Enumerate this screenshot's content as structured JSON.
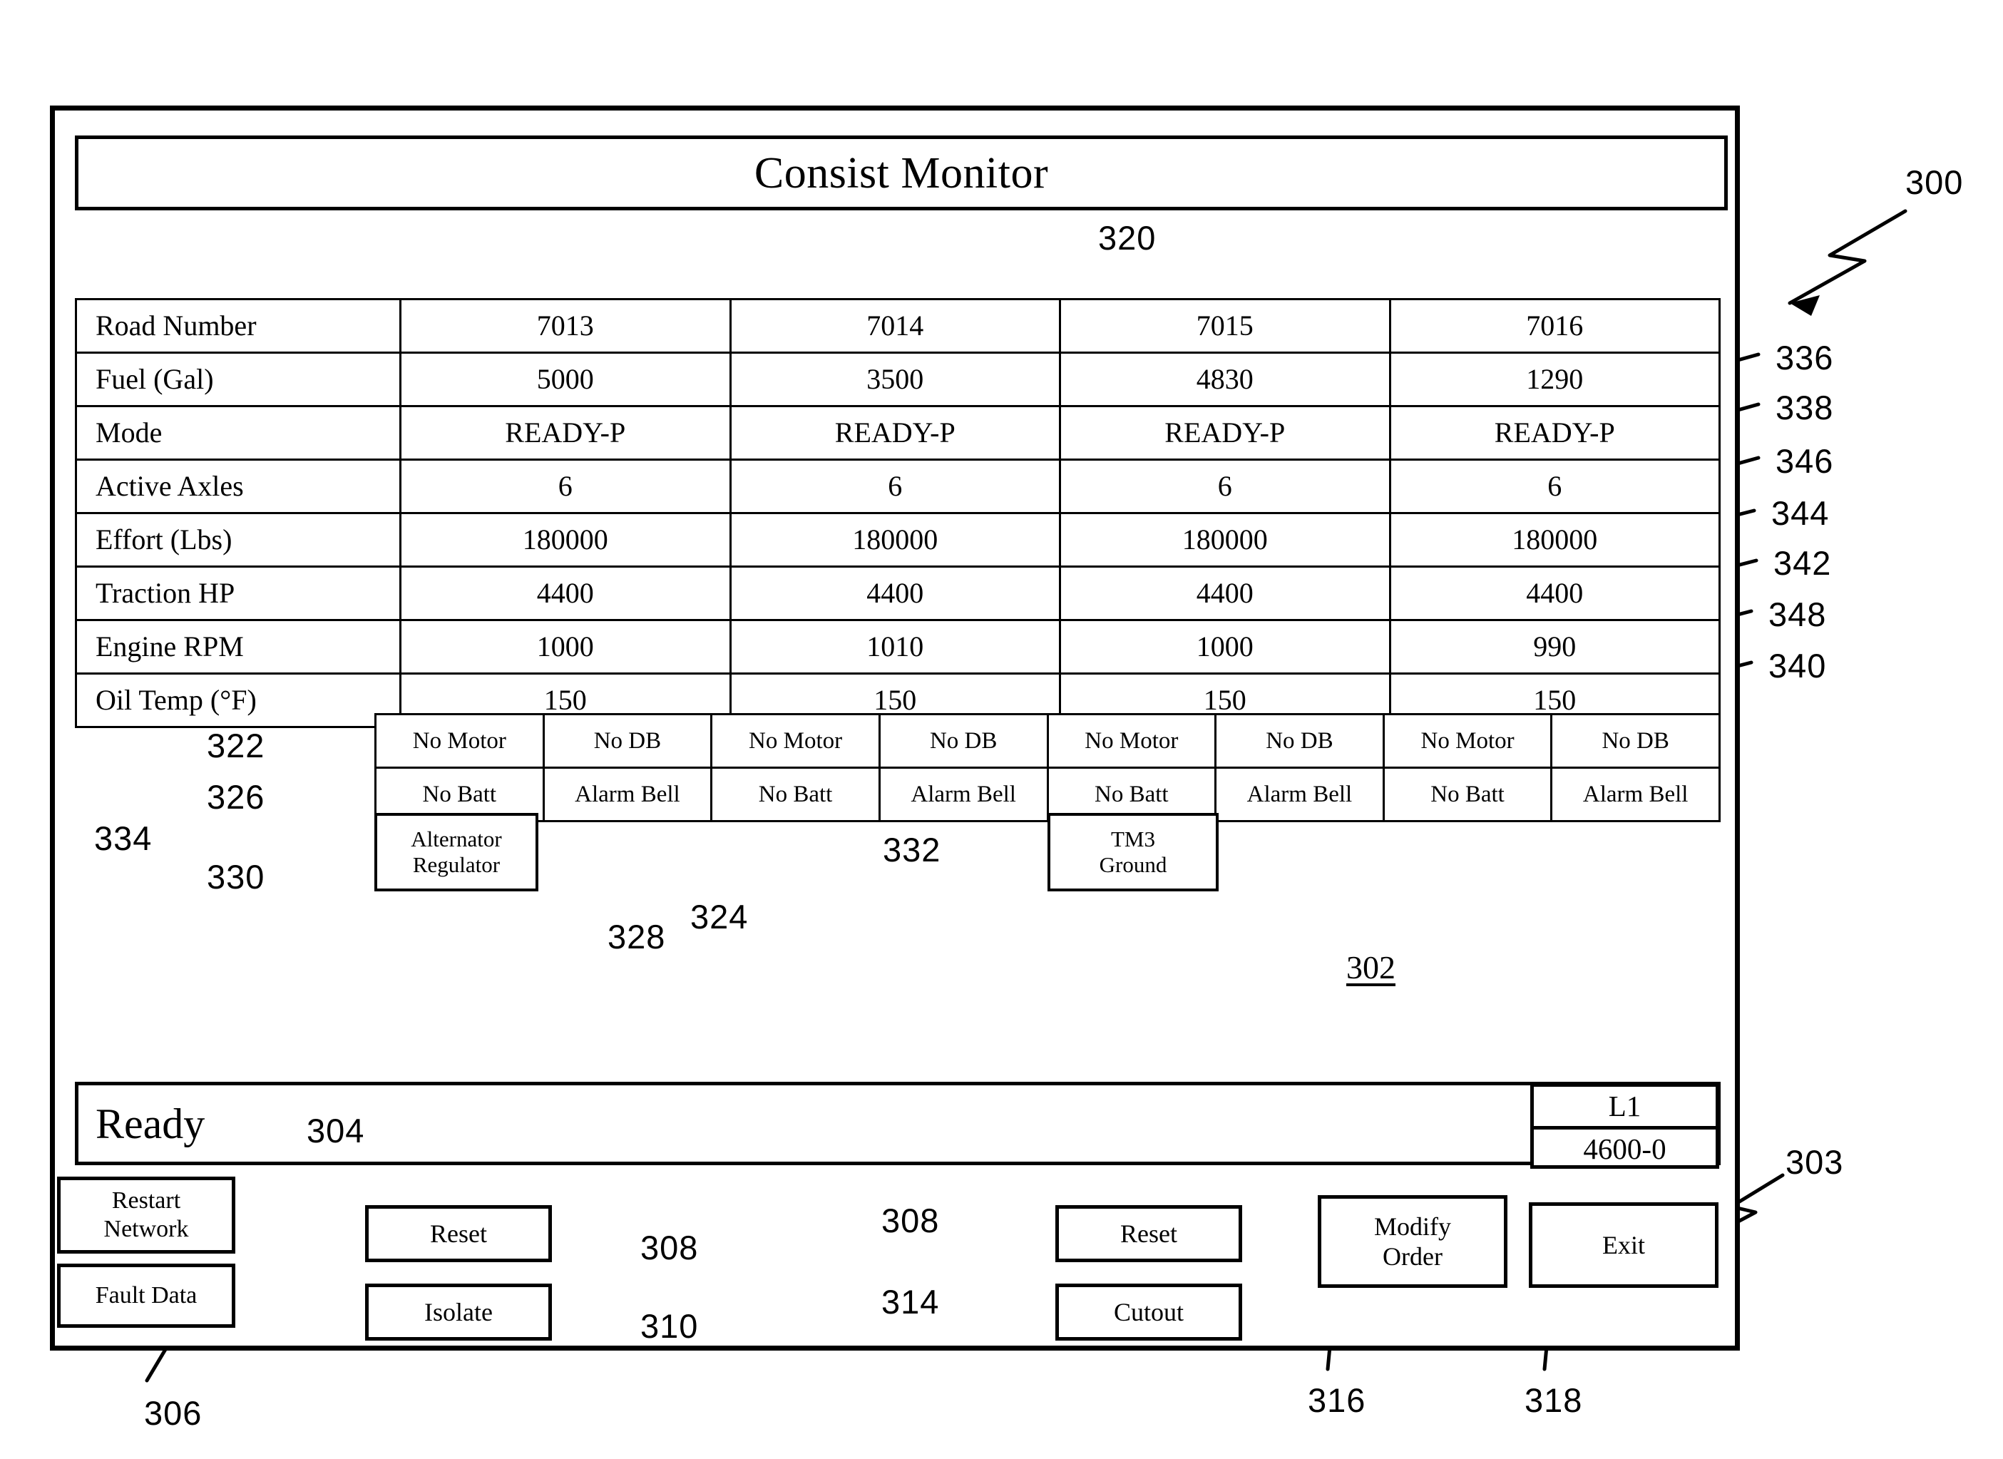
{
  "figure": {
    "main_ref": "300",
    "display_ref": "302",
    "panel_ref": "303",
    "table_ref": "320"
  },
  "header": {
    "title": "Consist Monitor"
  },
  "table": {
    "rows": [
      {
        "label": "Road Number",
        "values": [
          "7013",
          "7014",
          "7015",
          "7016"
        ]
      },
      {
        "label": "Fuel (Gal)",
        "values": [
          "5000",
          "3500",
          "4830",
          "1290"
        ]
      },
      {
        "label": "Mode",
        "values": [
          "READY-P",
          "READY-P",
          "READY-P",
          "READY-P"
        ]
      },
      {
        "label": "Active Axles",
        "values": [
          "6",
          "6",
          "6",
          "6"
        ]
      },
      {
        "label": "Effort (Lbs)",
        "values": [
          "180000",
          "180000",
          "180000",
          "180000"
        ]
      },
      {
        "label": "Traction HP",
        "values": [
          "4400",
          "4400",
          "4400",
          "4400"
        ]
      },
      {
        "label": "Engine RPM",
        "values": [
          "1000",
          "1010",
          "1000",
          "990"
        ]
      },
      {
        "label": "Oil Temp (°F)",
        "values": [
          "150",
          "150",
          "150",
          "150"
        ]
      }
    ]
  },
  "faults": {
    "row_top": [
      "No Motor",
      "No DB",
      "No Motor",
      "No DB",
      "No Motor",
      "No DB",
      "No Motor",
      "No DB"
    ],
    "row_bottom": [
      "No Batt",
      "Alarm Bell",
      "No Batt",
      "Alarm Bell",
      "No Batt",
      "Alarm Bell",
      "No Batt",
      "Alarm Bell"
    ],
    "alternator_regulator": "Alternator\nRegulator",
    "alternator_regulator_line1": "Alternator",
    "alternator_regulator_line2": "Regulator",
    "tm3_ground_line1": "TM3",
    "tm3_ground_line2": "Ground"
  },
  "status": {
    "text": "Ready",
    "loco_id": "L1",
    "loco_code": "4600-0"
  },
  "buttons": {
    "restart_network_line1": "Restart",
    "restart_network_line2": "Network",
    "fault_data": "Fault Data",
    "reset_left": "Reset",
    "isolate": "Isolate",
    "reset_right": "Reset",
    "cutout": "Cutout",
    "modify_order_line1": "Modify",
    "modify_order_line2": "Order",
    "exit": "Exit"
  },
  "refs": {
    "r300": "300",
    "r302": "302",
    "r303": "303",
    "r304": "304",
    "r306": "306",
    "r308a": "308",
    "r308b": "308",
    "r310": "310",
    "r314": "314",
    "r316": "316",
    "r318": "318",
    "r320": "320",
    "r322": "322",
    "r324": "324",
    "r326": "326",
    "r328": "328",
    "r330": "330",
    "r332": "332",
    "r334": "334",
    "r336": "336",
    "r338": "338",
    "r340": "340",
    "r342": "342",
    "r344": "344",
    "r346": "346",
    "r348": "348"
  },
  "colors": {
    "ink": "#000000",
    "paper": "#ffffff"
  }
}
